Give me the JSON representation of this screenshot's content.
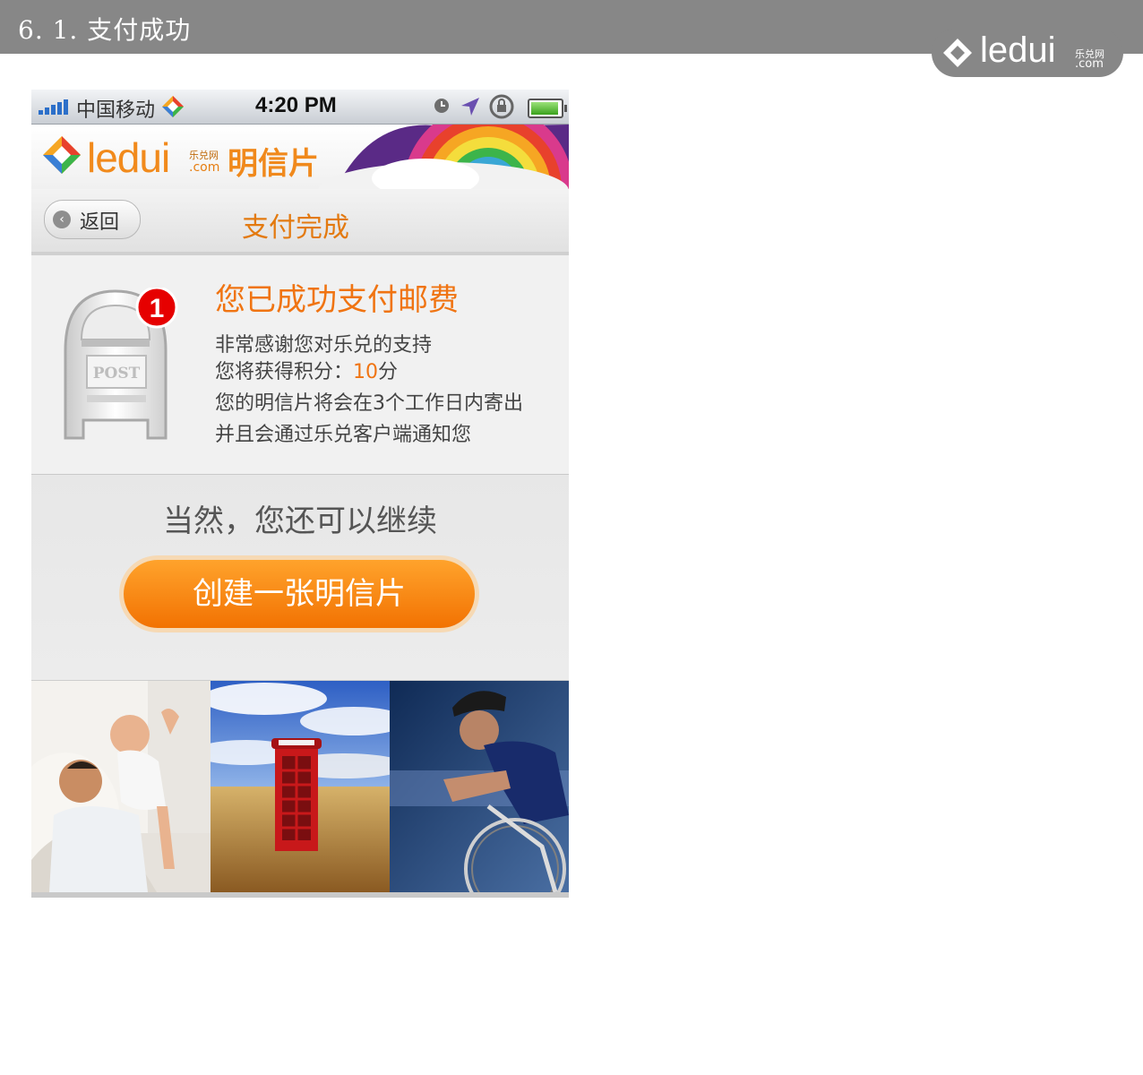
{
  "document": {
    "section_title": "6. 1. 支付成功",
    "brand": {
      "word": "ledui",
      "sub_cn": "乐兑网",
      "sub_domain": ".com"
    }
  },
  "status_bar": {
    "carrier": "中国移动",
    "time": "4:20 PM"
  },
  "banner": {
    "logo_word": "ledui",
    "logo_sub_cn": "乐兑网",
    "logo_sub_domain": ".com",
    "product": "明信片"
  },
  "navbar": {
    "back_label": "返回",
    "title": "支付完成"
  },
  "success": {
    "badge_count": "1",
    "mailbox_label": "POST",
    "title": "您已成功支付邮费",
    "thanks": "非常感谢您对乐兑的支持",
    "points_prefix": "您将获得积分：",
    "points_value": "10",
    "points_suffix": "分",
    "delivery": "您的明信片将会在3个工作日内寄出",
    "notify": "并且会通过乐兑客户端通知您"
  },
  "continue": {
    "title": "当然，您还可以继续",
    "button_label": "创建一张明信片"
  },
  "gallery": {
    "tiles": [
      "father-baby-photo",
      "phone-booth-photo",
      "cyclist-photo"
    ]
  },
  "colors": {
    "accent": "#f07412",
    "header_gray": "#878787"
  }
}
